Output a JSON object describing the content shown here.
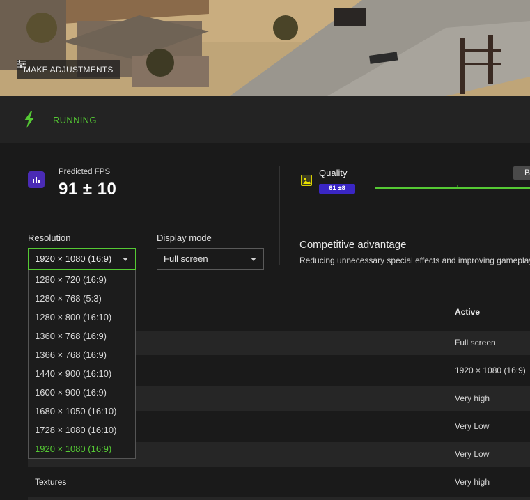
{
  "hero": {
    "adjust_label": "MAKE ADJUSTMENTS"
  },
  "status": {
    "text": "RUNNING",
    "color": "#55c934"
  },
  "fps": {
    "label": "Predicted FPS",
    "value": "91 ± 10"
  },
  "quality": {
    "label": "Quality",
    "badge": "61 ±8",
    "preset_chip": "B"
  },
  "resolution": {
    "label": "Resolution",
    "selected": "1920 × 1080 (16:9)",
    "options": [
      "1280 × 720 (16:9)",
      "1280 × 768 (5:3)",
      "1280 × 800 (16:10)",
      "1360 × 768 (16:9)",
      "1366 × 768 (16:9)",
      "1440 × 900 (16:10)",
      "1600 × 900 (16:9)",
      "1680 × 1050 (16:10)",
      "1728 × 1080 (16:10)",
      "1920 × 1080 (16:9)"
    ]
  },
  "display_mode": {
    "label": "Display mode",
    "selected": "Full screen"
  },
  "competitive": {
    "title": "Competitive advantage",
    "description": "Reducing unnecessary special effects and improving gameplay"
  },
  "table": {
    "active_header": "Active",
    "rows": [
      {
        "name": "",
        "active": "Full screen"
      },
      {
        "name": "",
        "active": "1920 × 1080 (16:9)"
      },
      {
        "name": "",
        "active": "Very high"
      },
      {
        "name": "",
        "active": "Very Low"
      },
      {
        "name": "",
        "active": "Very Low"
      },
      {
        "name": "Textures",
        "active": "Very high"
      }
    ]
  },
  "colors": {
    "accent": "#55c934",
    "purple": "#4a2bb5",
    "badge": "#3a26c4"
  }
}
